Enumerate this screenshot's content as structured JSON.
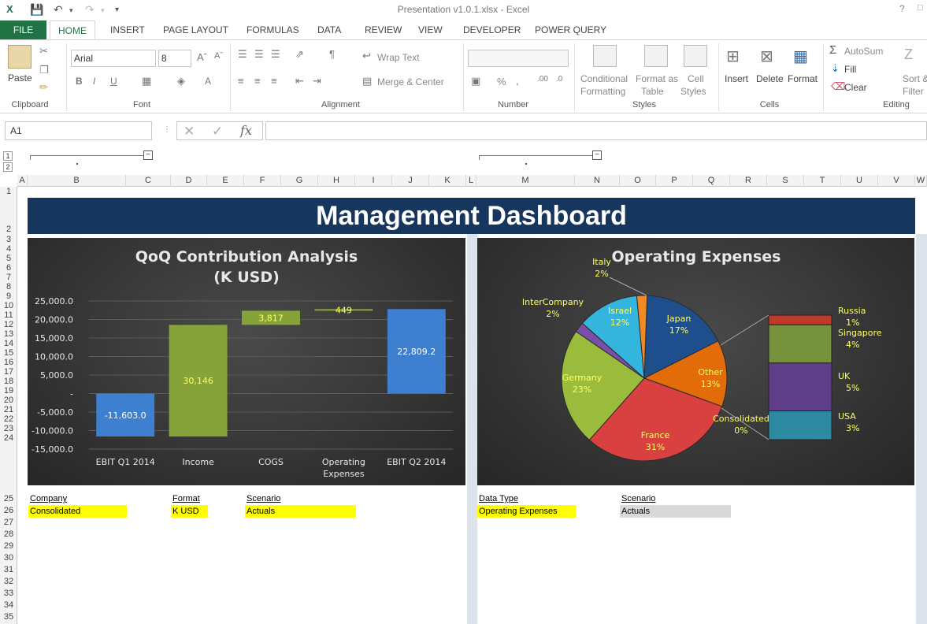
{
  "window": {
    "title": "Presentation v1.0.1.xlsx - Excel",
    "help": "?"
  },
  "tabs": [
    "FILE",
    "HOME",
    "INSERT",
    "PAGE LAYOUT",
    "FORMULAS",
    "DATA",
    "REVIEW",
    "VIEW",
    "DEVELOPER",
    "POWER QUERY"
  ],
  "ribbon": {
    "clipboard": {
      "label": "Clipboard",
      "paste": "Paste"
    },
    "font": {
      "label": "Font",
      "name": "Arial",
      "size": "8",
      "bold": "B",
      "italic": "I",
      "underline": "U",
      "font_color": "A"
    },
    "alignment": {
      "label": "Alignment",
      "wrap": "Wrap Text",
      "merge": "Merge & Center"
    },
    "number": {
      "label": "Number",
      "percent": "%"
    },
    "styles": {
      "label": "Styles",
      "cond1": "Conditional",
      "cond2": "Formatting",
      "fmt1": "Format as",
      "fmt2": "Table",
      "cell1": "Cell",
      "cell2": "Styles"
    },
    "cells": {
      "label": "Cells",
      "insert": "Insert",
      "delete": "Delete",
      "format": "Format"
    },
    "editing": {
      "label": "Editing",
      "autosum": "AutoSum",
      "fill": "Fill",
      "clear": "Clear",
      "sort1": "Sort &",
      "sort2": "Filter"
    }
  },
  "formula_bar": {
    "name_box": "A1",
    "fx": "fx",
    "formula": ""
  },
  "outline_levels": [
    "1",
    "2"
  ],
  "columns": [
    "A",
    "B",
    "C",
    "D",
    "E",
    "F",
    "G",
    "H",
    "I",
    "J",
    "K",
    "L",
    "M",
    "N",
    "O",
    "P",
    "Q",
    "R",
    "S",
    "T",
    "U",
    "V",
    "W"
  ],
  "rows": [
    "1",
    "2",
    "3",
    "4",
    "5",
    "6",
    "7",
    "8",
    "9",
    "10",
    "11",
    "12",
    "13",
    "14",
    "15",
    "16",
    "17",
    "18",
    "19",
    "20",
    "21",
    "22",
    "23",
    "24",
    "25",
    "26",
    "27",
    "28",
    "29",
    "30",
    "31",
    "32",
    "33",
    "34",
    "35"
  ],
  "dashboard": {
    "title": "Management Dashboard"
  },
  "left_filters": {
    "company_label": "Company",
    "company_value": "Consolidated",
    "format_label": "Format",
    "format_value": "K USD",
    "scenario_label": "Scenario",
    "scenario_value": "Actuals"
  },
  "right_filters": {
    "datatype_label": "Data Type",
    "datatype_value": "Operating Expenses",
    "scenario_label": "Scenario",
    "scenario_value": "Actuals"
  },
  "colors": {
    "accent": "#217346",
    "banner": "#17365d",
    "filter_yellow": "#ffff00"
  },
  "chart_data": [
    {
      "type": "bar",
      "subtype": "waterfall",
      "title": "QoQ Contribution Analysis",
      "subtitle": "(K USD)",
      "categories": [
        "EBIT Q1 2014",
        "Income",
        "COGS",
        "Operating Expenses",
        "EBIT Q2 2014"
      ],
      "bars": [
        {
          "start": 0,
          "end": -11603.0,
          "label": "-11,603.0",
          "color": "#3f7fd0"
        },
        {
          "start": -11603.0,
          "end": 18543.0,
          "label": "30,146",
          "color": "#86a33a"
        },
        {
          "start": 18543.0,
          "end": 22360.0,
          "label": "3,817",
          "color": "#86a33a"
        },
        {
          "start": 22360.0,
          "end": 22809.2,
          "label": "449",
          "color": "#86a33a"
        },
        {
          "start": 0,
          "end": 22809.2,
          "label": "22,809.2",
          "color": "#3f7fd0"
        }
      ],
      "yticks": [
        "25,000.0",
        "20,000.0",
        "15,000.0",
        "10,000.0",
        "5,000.0",
        "-",
        "-5,000.0",
        "-10,000.0",
        "-15,000.0"
      ],
      "ylim": [
        -15000,
        25000
      ],
      "grid": true
    },
    {
      "type": "pie",
      "subtype": "pie-of-bar",
      "title": "Operating Expenses",
      "slices": [
        {
          "name": "Japan",
          "value": 17,
          "label": "17%",
          "color": "#1f4e8c"
        },
        {
          "name": "Other",
          "value": 13,
          "label": "13%",
          "color": "#e26b0a"
        },
        {
          "name": "Consolidated",
          "value": 0,
          "label": "0%",
          "color": "#cccccc"
        },
        {
          "name": "France",
          "value": 31,
          "label": "31%",
          "color": "#d94040"
        },
        {
          "name": "Germany",
          "value": 23,
          "label": "23%",
          "color": "#9bbb3c"
        },
        {
          "name": "InterCompany",
          "value": 2,
          "label": "2%",
          "color": "#7b4fa8"
        },
        {
          "name": "Israel",
          "value": 12,
          "label": "12%",
          "color": "#33b5dd"
        },
        {
          "name": "Italy",
          "value": 2,
          "label": "2%",
          "color": "#f08a24"
        }
      ],
      "bar_stack": [
        {
          "name": "Russia",
          "value": 1,
          "label": "1%",
          "color": "#c0392b"
        },
        {
          "name": "Singapore",
          "value": 4,
          "label": "4%",
          "color": "#76923c"
        },
        {
          "name": "UK",
          "value": 5,
          "label": "5%",
          "color": "#5f3f87"
        },
        {
          "name": "USA",
          "value": 3,
          "label": "3%",
          "color": "#2d8aa0"
        }
      ]
    }
  ]
}
